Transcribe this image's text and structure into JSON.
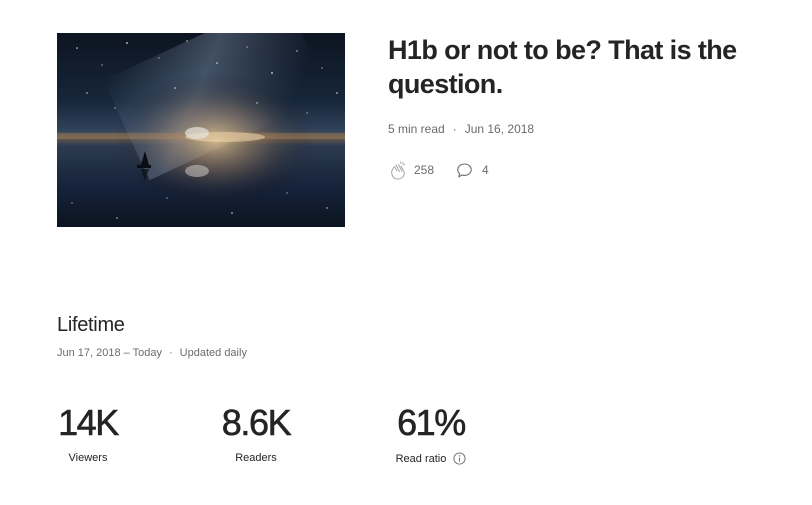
{
  "story": {
    "title": "H1b or not to be? That is the question.",
    "read_time": "5 min read",
    "separator": "·",
    "date": "Jun 16, 2018",
    "claps": "258",
    "responses": "4"
  },
  "icons": {
    "clap": "clap-icon",
    "response": "speech-bubble-icon",
    "info": "info-icon"
  },
  "lifetime": {
    "heading": "Lifetime",
    "range": "Jun 17, 2018 – Today",
    "separator": "·",
    "update": "Updated daily",
    "stats": [
      {
        "value": "14K",
        "label": "Viewers"
      },
      {
        "value": "8.6K",
        "label": "Readers"
      },
      {
        "value": "61%",
        "label": "Read ratio"
      }
    ]
  },
  "colors": {
    "text": "#242424",
    "muted": "#6b6b6b"
  }
}
